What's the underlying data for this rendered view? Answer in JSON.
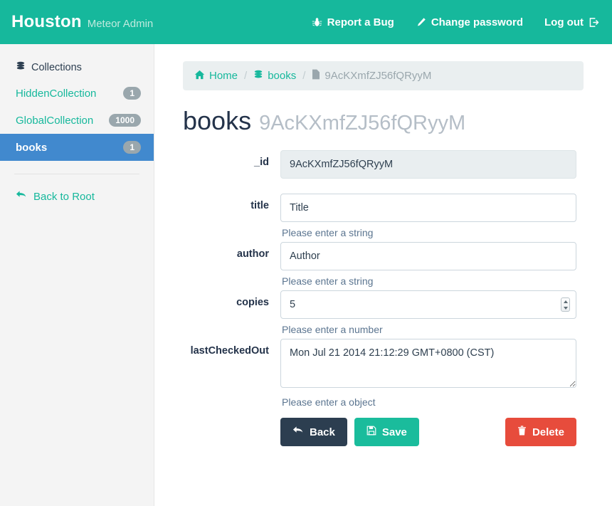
{
  "header": {
    "brand_name": "Houston",
    "brand_sub": "Meteor Admin",
    "nav": [
      {
        "label": "Report a Bug",
        "icon": "bug-icon"
      },
      {
        "label": "Change password",
        "icon": "pencil-icon"
      },
      {
        "label": "Log out",
        "icon": "sign-out-icon"
      }
    ]
  },
  "sidebar": {
    "heading": "Collections",
    "heading_icon": "database-icon",
    "items": [
      {
        "label": "HiddenCollection",
        "badge": "1",
        "active": false
      },
      {
        "label": "GlobalCollection",
        "badge": "1000",
        "active": false
      },
      {
        "label": "books",
        "badge": "1",
        "active": true
      }
    ],
    "back_to_root": "Back to Root",
    "back_icon": "back-arrow-icon"
  },
  "breadcrumb": {
    "home": "Home",
    "collection": "books",
    "document": "9AcKXmfZJ56fQRyyM",
    "separator": "/"
  },
  "page": {
    "title": "books",
    "subtitle": "9AcKXmfZJ56fQRyyM"
  },
  "form": {
    "fields": [
      {
        "label": "_id",
        "value": "9AcKXmfZJ56fQRyyM",
        "help": "",
        "type": "text",
        "disabled": true
      },
      {
        "label": "title",
        "value": "Title",
        "help": "Please enter a string",
        "type": "text",
        "disabled": false
      },
      {
        "label": "author",
        "value": "Author",
        "help": "Please enter a string",
        "type": "text",
        "disabled": false
      },
      {
        "label": "copies",
        "value": "5",
        "help": "Please enter a number",
        "type": "number",
        "disabled": false
      },
      {
        "label": "lastCheckedOut",
        "value": "Mon Jul 21 2014 21:12:29 GMT+0800 (CST)",
        "help": "Please enter a object",
        "type": "textarea",
        "disabled": false
      }
    ]
  },
  "actions": {
    "back": "Back",
    "save": "Save",
    "delete": "Delete"
  },
  "colors": {
    "brand_teal": "#16b89c",
    "active_blue": "#4189ce",
    "danger_red": "#e74c3c",
    "dark_navy": "#2c3e50",
    "badge_grey": "#9aa7ad"
  }
}
